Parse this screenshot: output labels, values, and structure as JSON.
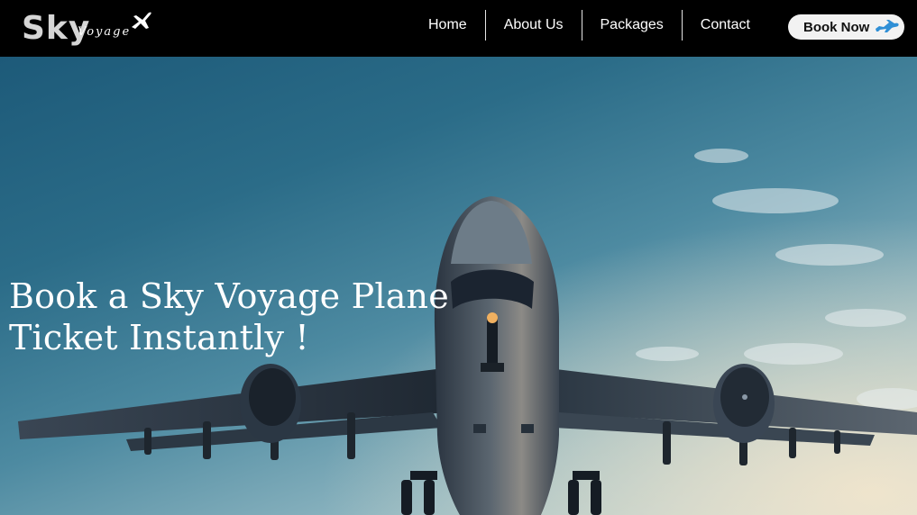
{
  "brand": {
    "name_primary": "Sky",
    "name_secondary": "Voyage",
    "plane_icon": "airplane-icon"
  },
  "nav": {
    "items": [
      {
        "label": "Home"
      },
      {
        "label": "About Us"
      },
      {
        "label": "Packages"
      },
      {
        "label": "Contact"
      }
    ],
    "cta_label": "Book Now",
    "cta_icon": "airplane-icon"
  },
  "hero": {
    "title_line1": "Book a Sky Voyage Plane",
    "title_line2": "Ticket Instantly !",
    "image": "airplane-takeoff-photo"
  },
  "colors": {
    "nav_bg": "#000000",
    "cta_bg": "#f2f2f2",
    "cta_icon": "#2f8fd6",
    "sky_top": "#1d5a79",
    "sky_bottom": "#c9d9d6"
  }
}
